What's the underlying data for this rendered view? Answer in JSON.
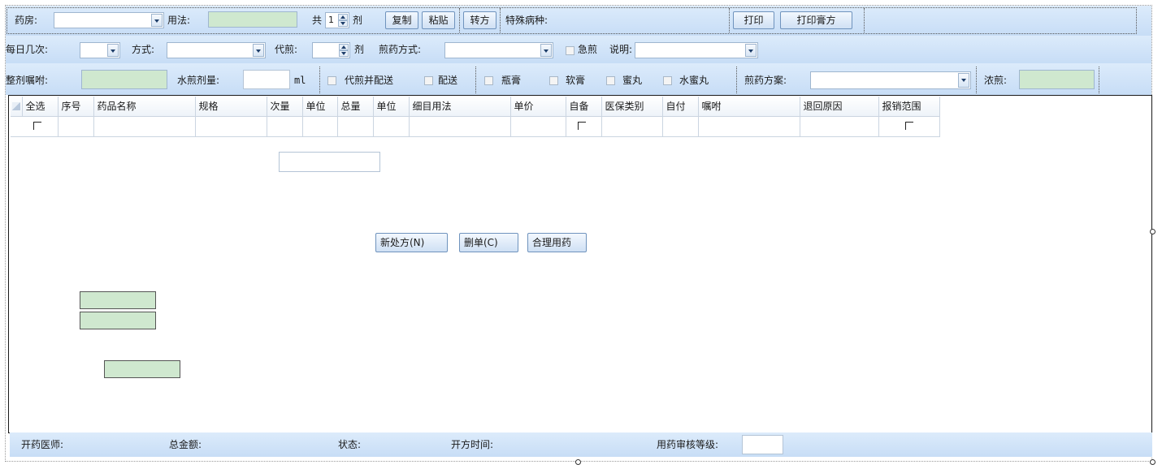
{
  "row1": {
    "pharmacy_label": "药房:",
    "usage_label": "用法:",
    "total_prefix": "共",
    "dose_count": "1",
    "dose_unit": "剂",
    "copy_button": "复制",
    "paste_button": "粘贴",
    "convert_button": "转方",
    "special_disease_label": "特殊病种:",
    "print_button": "打印",
    "print_paste_button": "打印膏方"
  },
  "row2": {
    "times_per_day_label": "每日几次:",
    "method_label": "方式:",
    "decoct_label": "代煎:",
    "decoct_unit": "剂",
    "decoct_method_label": "煎药方式:",
    "urgent_label": "急煎",
    "note_label": "说明:"
  },
  "row3": {
    "whole_advice_label": "整剂嘱咐:",
    "water_amount_label": "水煎剂量:",
    "water_unit": "ml",
    "decoct_delivery_label": "代煎并配送",
    "delivery_label": "配送",
    "bottle_paste_label": "瓶膏",
    "soft_paste_label": "软膏",
    "honey_pill_label": "蜜丸",
    "water_honey_pill_label": "水蜜丸",
    "decoct_plan_label": "煎药方案:",
    "concentrate_label": "浓煎:"
  },
  "grid": {
    "columns": [
      "全选",
      "序号",
      "药品名称",
      "规格",
      "次量",
      "单位",
      "总量",
      "单位",
      "细目用法",
      "单价",
      "自备",
      "医保类别",
      "自付",
      "嘱咐",
      "退回原因",
      "报销范围"
    ]
  },
  "actions": {
    "new_prescription": "新处方(N)",
    "delete_order": "删单(C)",
    "rational_drug": "合理用药"
  },
  "status": {
    "doctor_label": "开药医师:",
    "total_amount_label": "总金额:",
    "state_label": "状态:",
    "time_label": "开方时间:",
    "audit_level_label": "用药审核等级:"
  }
}
